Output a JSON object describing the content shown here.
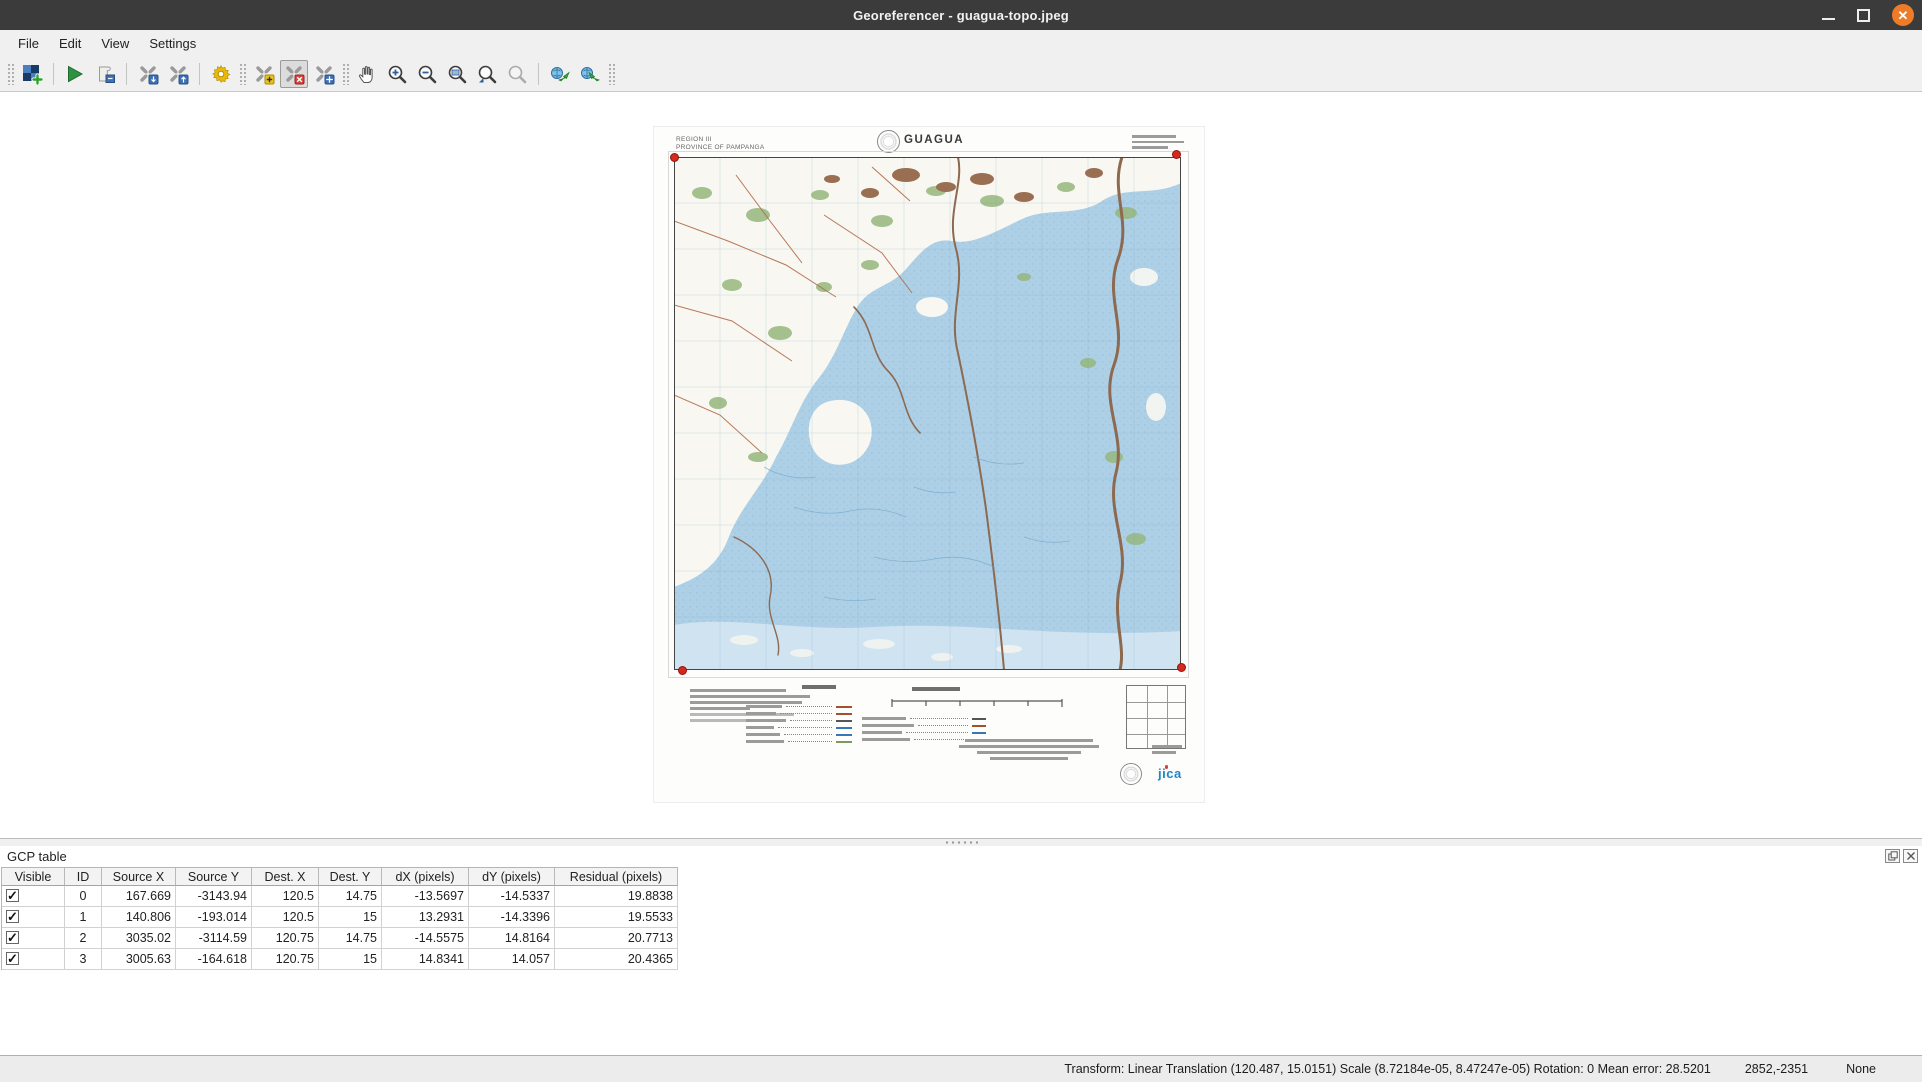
{
  "window": {
    "title": "Georeferencer - guagua-topo.jpeg"
  },
  "menu": [
    "File",
    "Edit",
    "View",
    "Settings"
  ],
  "toolbar": [
    {
      "t": "handle"
    },
    {
      "t": "btn",
      "name": "open-raster"
    },
    {
      "t": "sep"
    },
    {
      "t": "btn",
      "name": "start-georeferencing"
    },
    {
      "t": "btn",
      "name": "generate-gdal-script"
    },
    {
      "t": "sep"
    },
    {
      "t": "btn",
      "name": "load-gcp-points"
    },
    {
      "t": "btn",
      "name": "save-gcp-points"
    },
    {
      "t": "sep"
    },
    {
      "t": "btn",
      "name": "transformation-settings"
    },
    {
      "t": "handle"
    },
    {
      "t": "btn",
      "name": "add-point"
    },
    {
      "t": "btn",
      "name": "delete-point",
      "pressed": true
    },
    {
      "t": "btn",
      "name": "move-point"
    },
    {
      "t": "handle"
    },
    {
      "t": "btn",
      "name": "pan"
    },
    {
      "t": "btn",
      "name": "zoom-in"
    },
    {
      "t": "btn",
      "name": "zoom-out"
    },
    {
      "t": "btn",
      "name": "zoom-to-layer"
    },
    {
      "t": "btn",
      "name": "zoom-last"
    },
    {
      "t": "btn",
      "name": "zoom-next",
      "disabled": true
    },
    {
      "t": "sep"
    },
    {
      "t": "btn",
      "name": "link-georeferencer-to-qgis"
    },
    {
      "t": "btn",
      "name": "link-qgis-to-georeferencer"
    },
    {
      "t": "handle"
    }
  ],
  "map_sheet": {
    "region_line1": "REGION III",
    "region_line2": "PROVINCE OF PAMPANGA",
    "title": "GUAGUA",
    "agency_logo": "jica"
  },
  "gcp_panel": {
    "title": "GCP table",
    "columns": [
      "Visible",
      "ID",
      "Source X",
      "Source Y",
      "Dest. X",
      "Dest. Y",
      "dX (pixels)",
      "dY (pixels)",
      "Residual (pixels)"
    ],
    "rows": [
      {
        "visible": true,
        "id": "0",
        "source_x": "167.669",
        "source_y": "-3143.94",
        "dest_x": "120.5",
        "dest_y": "14.75",
        "dx": "-13.5697",
        "dy": "-14.5337",
        "residual": "19.8838"
      },
      {
        "visible": true,
        "id": "1",
        "source_x": "140.806",
        "source_y": "-193.014",
        "dest_x": "120.5",
        "dest_y": "15",
        "dx": "13.2931",
        "dy": "-14.3396",
        "residual": "19.5533"
      },
      {
        "visible": true,
        "id": "2",
        "source_x": "3035.02",
        "source_y": "-3114.59",
        "dest_x": "120.75",
        "dest_y": "14.75",
        "dx": "-14.5575",
        "dy": "14.8164",
        "residual": "20.7713"
      },
      {
        "visible": true,
        "id": "3",
        "source_x": "3005.63",
        "source_y": "-164.618",
        "dest_x": "120.75",
        "dest_y": "15",
        "dx": "14.8341",
        "dy": "14.057",
        "residual": "20.4365"
      }
    ]
  },
  "status_bar": {
    "transform_text": "Transform: Linear Translation (120.487, 15.0151) Scale (8.72184e-05, 8.47247e-05) Rotation: 0 Mean error: 28.5201",
    "cursor_coords": "2852,-2351",
    "rotation": "None"
  },
  "colors": {
    "title_bar": "#3b3b3b",
    "close_button": "#ee7b28",
    "gcp_marker": "#d42a1e",
    "map_water": "#aed0e6",
    "jica_blue": "#1f86c9"
  }
}
